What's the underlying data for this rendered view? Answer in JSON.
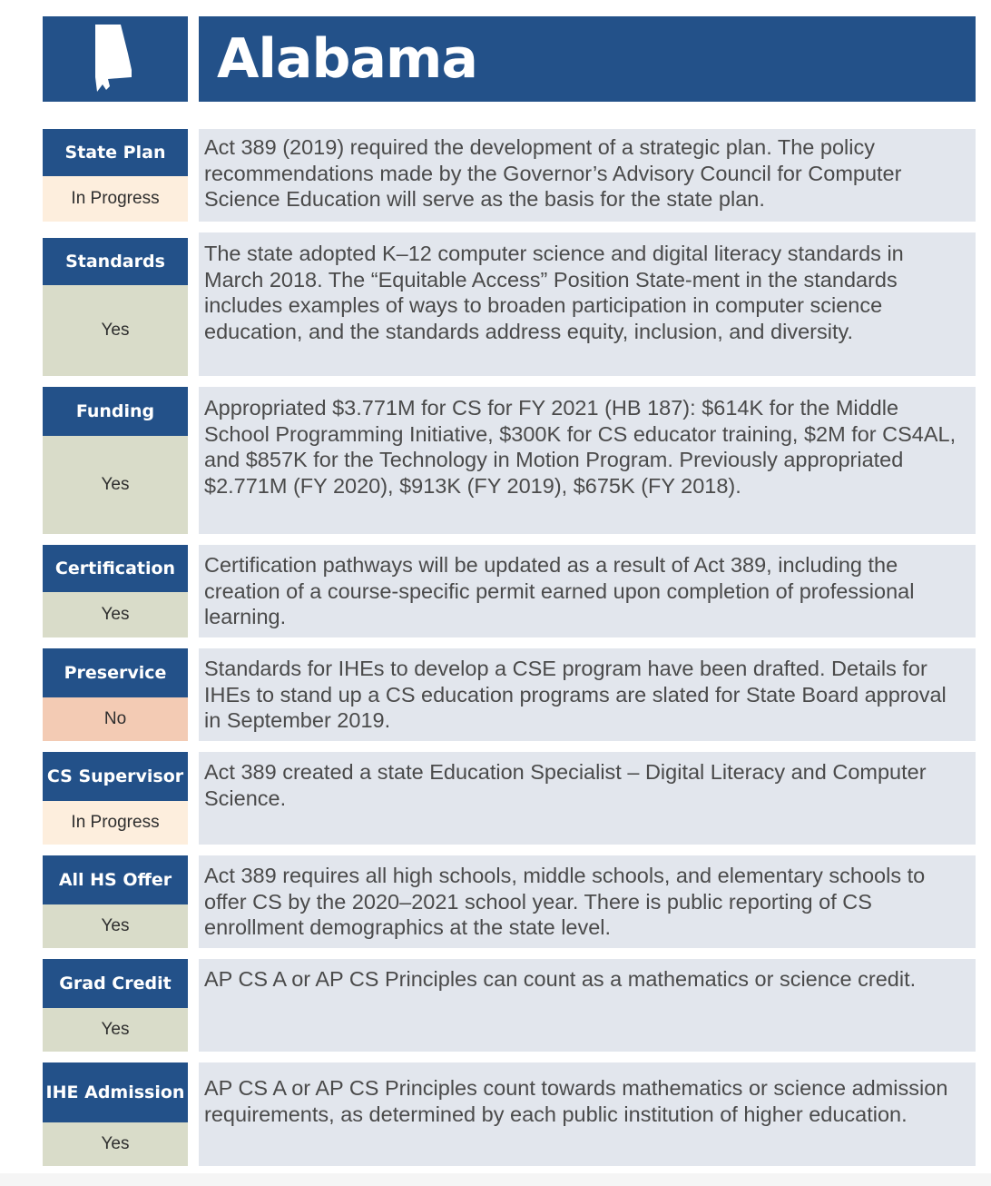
{
  "header": {
    "title": "Alabama",
    "icon": "alabama-state-silhouette-icon"
  },
  "colors": {
    "navy": "#235189",
    "yes": "#d9dcc9",
    "in_progress": "#fdeedd",
    "no": "#f3cbb4",
    "panel": "#e2e6ed"
  },
  "rows": [
    {
      "label": "State Plan",
      "status": "In Progress",
      "description": "Act 389 (2019) required the development of a strategic plan. The policy recommendations made by the Governor’s Advisory Council for Computer Science Education will serve as the basis for the state plan."
    },
    {
      "label": "Standards",
      "status": "Yes",
      "description": "The state adopted K–12 computer science and digital literacy standards in March 2018. The “Equitable Access” Position State-ment in the standards includes examples of ways to broaden participation in computer science education, and the standards address equity, inclusion, and diversity."
    },
    {
      "label": "Funding",
      "status": "Yes",
      "description": "Appropriated $3.771M for CS for FY 2021 (HB 187): $614K for the Middle School Programming Initiative, $300K for CS educator training, $2M for CS4AL, and $857K for the Technology in Motion Program. Previously appropriated $2.771M (FY 2020), $913K (FY 2019), $675K (FY 2018)."
    },
    {
      "label": "Certification",
      "status": "Yes",
      "description": "Certification pathways will be updated as a result of Act 389, including the creation of a course-specific permit earned upon completion of professional learning."
    },
    {
      "label": "Preservice",
      "status": "No",
      "description": "Standards for IHEs to develop a CSE program have been drafted. Details for IHEs to stand up a CS education programs are slated for State Board approval in September 2019."
    },
    {
      "label": "CS Supervisor",
      "status": "In Progress",
      "description": "Act 389 created a state Education Specialist – Digital Literacy and Computer Science."
    },
    {
      "label": "All HS Offer",
      "status": "Yes",
      "description": "Act 389 requires all high schools, middle schools, and elementary schools to offer CS by the 2020–2021 school year. There is public reporting of CS enrollment demographics at the state level."
    },
    {
      "label": "Grad Credit",
      "status": "Yes",
      "description": "AP CS A or AP CS Principles can count as a mathematics or science credit."
    },
    {
      "label": "IHE Admission",
      "status": "Yes",
      "description": "AP CS A or AP CS Principles count towards mathematics or science admission requirements, as determined by each public institution of higher education."
    }
  ]
}
